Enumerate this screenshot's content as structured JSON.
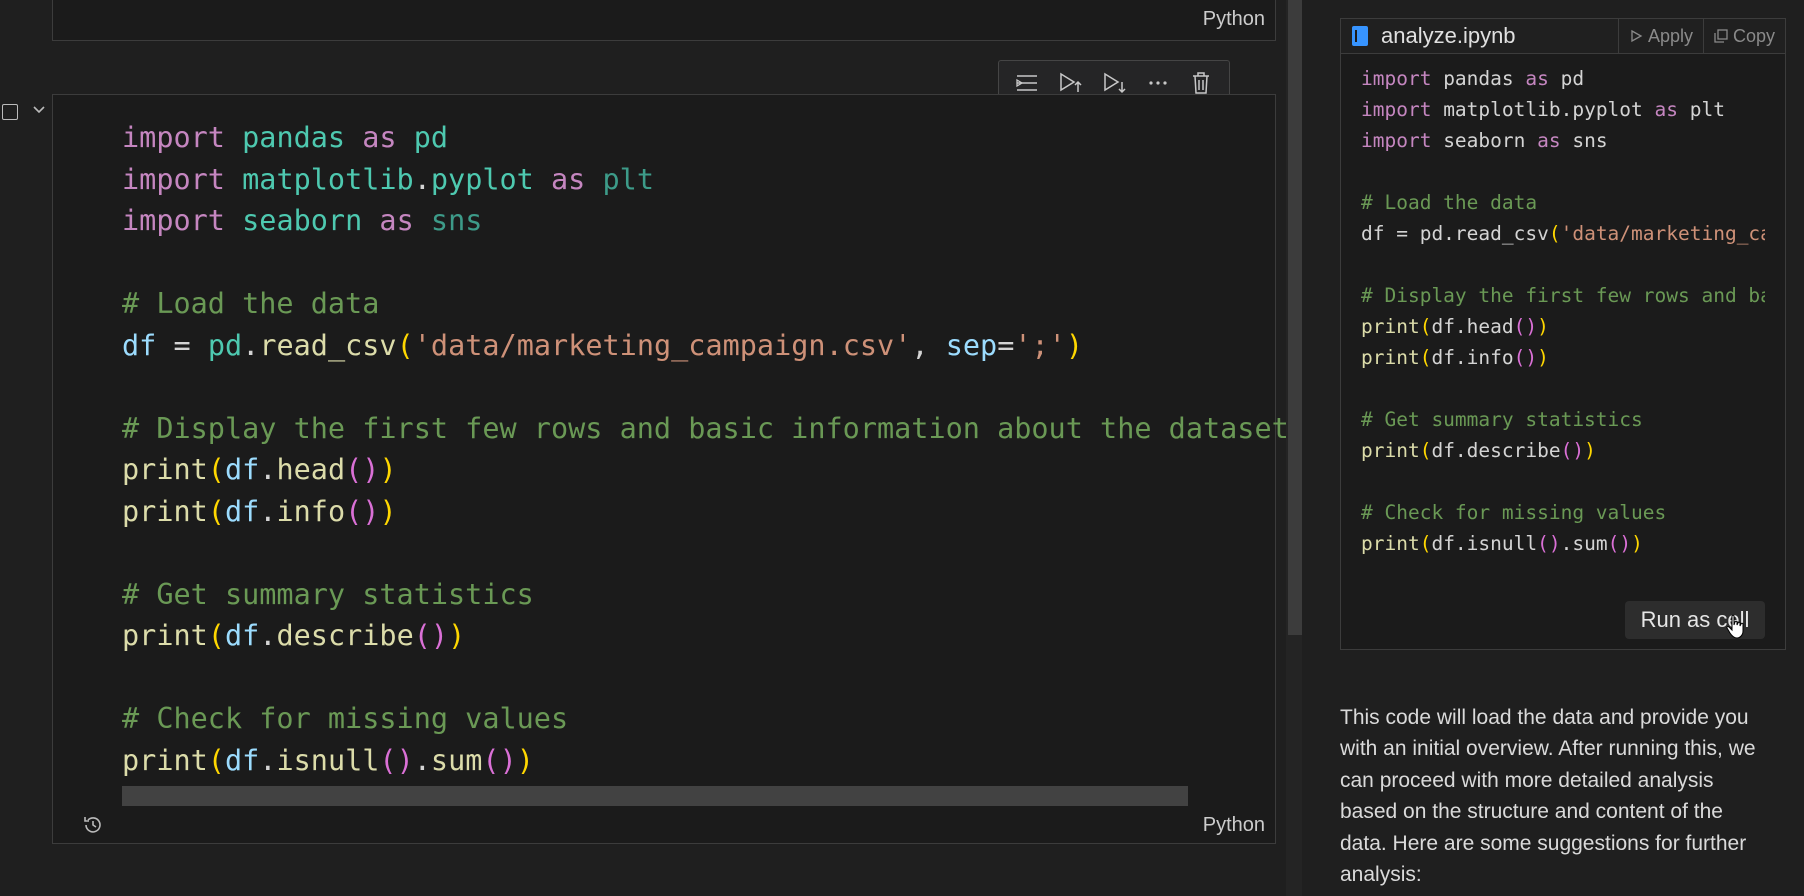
{
  "notebook": {
    "previous_cell": {
      "language": "Python"
    },
    "cell": {
      "language": "Python",
      "code_lines": [
        [
          {
            "t": "import",
            "c": "kw"
          },
          {
            "t": " ",
            "c": "plain"
          },
          {
            "t": "pandas",
            "c": "mod"
          },
          {
            "t": " ",
            "c": "plain"
          },
          {
            "t": "as",
            "c": "kw"
          },
          {
            "t": " ",
            "c": "plain"
          },
          {
            "t": "pd",
            "c": "mod"
          }
        ],
        [
          {
            "t": "import",
            "c": "kw"
          },
          {
            "t": " ",
            "c": "plain"
          },
          {
            "t": "matplotlib",
            "c": "mod"
          },
          {
            "t": ".",
            "c": "plain"
          },
          {
            "t": "pyplot",
            "c": "mod"
          },
          {
            "t": " ",
            "c": "plain"
          },
          {
            "t": "as",
            "c": "kw"
          },
          {
            "t": " ",
            "c": "plain"
          },
          {
            "t": "plt",
            "c": "mod2"
          }
        ],
        [
          {
            "t": "import",
            "c": "kw"
          },
          {
            "t": " ",
            "c": "plain"
          },
          {
            "t": "seaborn",
            "c": "mod"
          },
          {
            "t": " ",
            "c": "plain"
          },
          {
            "t": "as",
            "c": "kw"
          },
          {
            "t": " ",
            "c": "plain"
          },
          {
            "t": "sns",
            "c": "mod2"
          }
        ],
        [],
        [
          {
            "t": "# Load the data",
            "c": "com"
          }
        ],
        [
          {
            "t": "df",
            "c": "var"
          },
          {
            "t": " = ",
            "c": "plain"
          },
          {
            "t": "pd",
            "c": "mod"
          },
          {
            "t": ".",
            "c": "plain"
          },
          {
            "t": "read_csv",
            "c": "fn"
          },
          {
            "t": "(",
            "c": "p1"
          },
          {
            "t": "'data/marketing_campaign.csv'",
            "c": "str"
          },
          {
            "t": ", ",
            "c": "plain"
          },
          {
            "t": "sep",
            "c": "var"
          },
          {
            "t": "=",
            "c": "plain"
          },
          {
            "t": "';'",
            "c": "str"
          },
          {
            "t": ")",
            "c": "p1"
          }
        ],
        [],
        [
          {
            "t": "# Display the first few rows and basic information about the dataset",
            "c": "com"
          }
        ],
        [
          {
            "t": "print",
            "c": "fn"
          },
          {
            "t": "(",
            "c": "p1"
          },
          {
            "t": "df",
            "c": "var"
          },
          {
            "t": ".",
            "c": "plain"
          },
          {
            "t": "head",
            "c": "fn"
          },
          {
            "t": "()",
            "c": "p2"
          },
          {
            "t": ")",
            "c": "p1"
          }
        ],
        [
          {
            "t": "print",
            "c": "fn"
          },
          {
            "t": "(",
            "c": "p1"
          },
          {
            "t": "df",
            "c": "var"
          },
          {
            "t": ".",
            "c": "plain"
          },
          {
            "t": "info",
            "c": "fn"
          },
          {
            "t": "()",
            "c": "p2"
          },
          {
            "t": ")",
            "c": "p1"
          }
        ],
        [],
        [
          {
            "t": "# Get summary statistics",
            "c": "com"
          }
        ],
        [
          {
            "t": "print",
            "c": "fn"
          },
          {
            "t": "(",
            "c": "p1"
          },
          {
            "t": "df",
            "c": "var"
          },
          {
            "t": ".",
            "c": "plain"
          },
          {
            "t": "describe",
            "c": "fn"
          },
          {
            "t": "()",
            "c": "p2"
          },
          {
            "t": ")",
            "c": "p1"
          }
        ],
        [],
        [
          {
            "t": "# Check for missing values",
            "c": "com"
          }
        ],
        [
          {
            "t": "print",
            "c": "fn"
          },
          {
            "t": "(",
            "c": "p1"
          },
          {
            "t": "df",
            "c": "var"
          },
          {
            "t": ".",
            "c": "plain"
          },
          {
            "t": "isnull",
            "c": "fn"
          },
          {
            "t": "()",
            "c": "p2"
          },
          {
            "t": ".",
            "c": "plain"
          },
          {
            "t": "sum",
            "c": "fn"
          },
          {
            "t": "()",
            "c": "p2"
          },
          {
            "t": ")",
            "c": "p1"
          }
        ]
      ]
    },
    "toolbar": {
      "buttons": [
        {
          "name": "execute-above-icon"
        },
        {
          "name": "run-above-icon"
        },
        {
          "name": "run-below-icon"
        },
        {
          "name": "more-actions-icon"
        },
        {
          "name": "delete-cell-icon"
        }
      ]
    }
  },
  "chat": {
    "snippet": {
      "file_name": "analyze.ipynb",
      "apply_label": "Apply",
      "copy_label": "Copy",
      "run_label": "Run as cell",
      "code_lines": [
        [
          {
            "t": "import",
            "c": "kw"
          },
          {
            "t": " pandas ",
            "c": "plain"
          },
          {
            "t": "as",
            "c": "kw"
          },
          {
            "t": " pd",
            "c": "plain"
          }
        ],
        [
          {
            "t": "import",
            "c": "kw"
          },
          {
            "t": " matplotlib.pyplot ",
            "c": "plain"
          },
          {
            "t": "as",
            "c": "kw"
          },
          {
            "t": " plt",
            "c": "plain"
          }
        ],
        [
          {
            "t": "import",
            "c": "kw"
          },
          {
            "t": " seaborn ",
            "c": "plain"
          },
          {
            "t": "as",
            "c": "kw"
          },
          {
            "t": " sns",
            "c": "plain"
          }
        ],
        [],
        [
          {
            "t": "# Load the data",
            "c": "com"
          }
        ],
        [
          {
            "t": "df = pd.read_csv",
            "c": "plain"
          },
          {
            "t": "(",
            "c": "p1"
          },
          {
            "t": "'data/marketing_campaign.csv'",
            "c": "str"
          }
        ],
        [],
        [
          {
            "t": "# Display the first few rows and basic information about the dataset",
            "c": "com"
          }
        ],
        [
          {
            "t": "print",
            "c": "fn"
          },
          {
            "t": "(",
            "c": "p1"
          },
          {
            "t": "df.head",
            "c": "plain"
          },
          {
            "t": "()",
            "c": "p2"
          },
          {
            "t": ")",
            "c": "p1"
          }
        ],
        [
          {
            "t": "print",
            "c": "fn"
          },
          {
            "t": "(",
            "c": "p1"
          },
          {
            "t": "df.info",
            "c": "plain"
          },
          {
            "t": "()",
            "c": "p2"
          },
          {
            "t": ")",
            "c": "p1"
          }
        ],
        [],
        [
          {
            "t": "# Get summary statistics",
            "c": "com"
          }
        ],
        [
          {
            "t": "print",
            "c": "fn"
          },
          {
            "t": "(",
            "c": "p1"
          },
          {
            "t": "df.describe",
            "c": "plain"
          },
          {
            "t": "()",
            "c": "p2"
          },
          {
            "t": ")",
            "c": "p1"
          }
        ],
        [],
        [
          {
            "t": "# Check for missing values",
            "c": "com"
          }
        ],
        [
          {
            "t": "print",
            "c": "fn"
          },
          {
            "t": "(",
            "c": "p1"
          },
          {
            "t": "df.isnull",
            "c": "plain"
          },
          {
            "t": "()",
            "c": "p2"
          },
          {
            "t": ".sum",
            "c": "plain"
          },
          {
            "t": "()",
            "c": "p2"
          },
          {
            "t": ")",
            "c": "p1"
          }
        ]
      ]
    },
    "message": "This code will load the data and provide you with an initial overview. After running this, we can proceed with more detailed analysis based on the structure and content of the data. Here are some suggestions for further analysis:"
  }
}
